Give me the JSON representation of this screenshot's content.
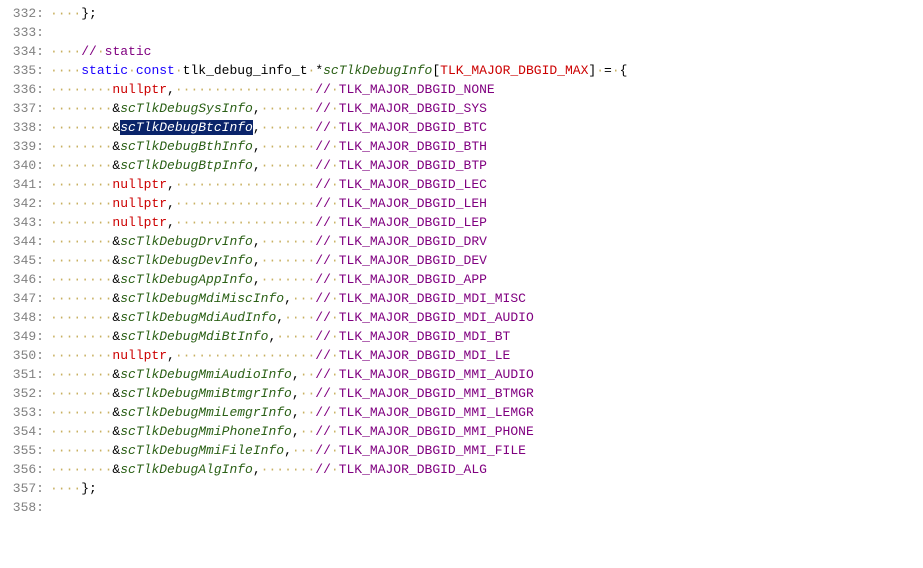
{
  "chart_data": null,
  "lines": [
    {
      "n": 332,
      "tokens": [
        {
          "t": "ws",
          "v": "····"
        },
        {
          "t": "num",
          "v": "};"
        }
      ]
    },
    {
      "n": 333,
      "tokens": []
    },
    {
      "n": 334,
      "tokens": [
        {
          "t": "ws",
          "v": "····"
        },
        {
          "t": "comment",
          "v": "//"
        },
        {
          "t": "ws",
          "v": "·"
        },
        {
          "t": "comment",
          "v": "static"
        }
      ]
    },
    {
      "n": 335,
      "tokens": [
        {
          "t": "ws",
          "v": "····"
        },
        {
          "t": "kw",
          "v": "static"
        },
        {
          "t": "ws",
          "v": "·"
        },
        {
          "t": "kw",
          "v": "const"
        },
        {
          "t": "ws",
          "v": "·"
        },
        {
          "t": "type",
          "v": "tlk_debug_info_t"
        },
        {
          "t": "ws",
          "v": "·"
        },
        {
          "t": "num",
          "v": "*"
        },
        {
          "t": "fn",
          "v": "scTlkDebugInfo"
        },
        {
          "t": "num",
          "v": "["
        },
        {
          "t": "red",
          "v": "TLK_MAJOR_DBGID_MAX"
        },
        {
          "t": "num",
          "v": "]"
        },
        {
          "t": "ws",
          "v": "·"
        },
        {
          "t": "num",
          "v": "="
        },
        {
          "t": "ws",
          "v": "·"
        },
        {
          "t": "num",
          "v": "{"
        }
      ]
    },
    {
      "n": 336,
      "tokens": [
        {
          "t": "ws",
          "v": "········"
        },
        {
          "t": "red",
          "v": "nullptr"
        },
        {
          "t": "num",
          "v": ","
        },
        {
          "t": "ws",
          "v": "··················"
        },
        {
          "t": "comment",
          "v": "//"
        },
        {
          "t": "ws",
          "v": "·"
        },
        {
          "t": "comment",
          "v": "TLK_MAJOR_DBGID_NONE"
        }
      ]
    },
    {
      "n": 337,
      "tokens": [
        {
          "t": "ws",
          "v": "········"
        },
        {
          "t": "num",
          "v": "&"
        },
        {
          "t": "fn",
          "v": "scTlkDebugSysInfo"
        },
        {
          "t": "num",
          "v": ","
        },
        {
          "t": "ws",
          "v": "·······"
        },
        {
          "t": "comment",
          "v": "//"
        },
        {
          "t": "ws",
          "v": "·"
        },
        {
          "t": "comment",
          "v": "TLK_MAJOR_DBGID_SYS"
        }
      ]
    },
    {
      "n": 338,
      "tokens": [
        {
          "t": "ws",
          "v": "········"
        },
        {
          "t": "num",
          "v": "&"
        },
        {
          "t": "fn",
          "v": "scTlkDebugBtcInfo",
          "sel": true
        },
        {
          "t": "num",
          "v": ","
        },
        {
          "t": "ws",
          "v": "·······"
        },
        {
          "t": "comment",
          "v": "//"
        },
        {
          "t": "ws",
          "v": "·"
        },
        {
          "t": "comment",
          "v": "TLK_MAJOR_DBGID_BTC"
        }
      ]
    },
    {
      "n": 339,
      "tokens": [
        {
          "t": "ws",
          "v": "········"
        },
        {
          "t": "num",
          "v": "&"
        },
        {
          "t": "fn",
          "v": "scTlkDebugBthInfo"
        },
        {
          "t": "num",
          "v": ","
        },
        {
          "t": "ws",
          "v": "·······"
        },
        {
          "t": "comment",
          "v": "//"
        },
        {
          "t": "ws",
          "v": "·"
        },
        {
          "t": "comment",
          "v": "TLK_MAJOR_DBGID_BTH"
        }
      ]
    },
    {
      "n": 340,
      "tokens": [
        {
          "t": "ws",
          "v": "········"
        },
        {
          "t": "num",
          "v": "&"
        },
        {
          "t": "fn",
          "v": "scTlkDebugBtpInfo"
        },
        {
          "t": "num",
          "v": ","
        },
        {
          "t": "ws",
          "v": "·······"
        },
        {
          "t": "comment",
          "v": "//"
        },
        {
          "t": "ws",
          "v": "·"
        },
        {
          "t": "comment",
          "v": "TLK_MAJOR_DBGID_BTP"
        }
      ]
    },
    {
      "n": 341,
      "tokens": [
        {
          "t": "ws",
          "v": "········"
        },
        {
          "t": "red",
          "v": "nullptr"
        },
        {
          "t": "num",
          "v": ","
        },
        {
          "t": "ws",
          "v": "··················"
        },
        {
          "t": "comment",
          "v": "//"
        },
        {
          "t": "ws",
          "v": "·"
        },
        {
          "t": "comment",
          "v": "TLK_MAJOR_DBGID_LEC"
        }
      ]
    },
    {
      "n": 342,
      "tokens": [
        {
          "t": "ws",
          "v": "········"
        },
        {
          "t": "red",
          "v": "nullptr"
        },
        {
          "t": "num",
          "v": ","
        },
        {
          "t": "ws",
          "v": "··················"
        },
        {
          "t": "comment",
          "v": "//"
        },
        {
          "t": "ws",
          "v": "·"
        },
        {
          "t": "comment",
          "v": "TLK_MAJOR_DBGID_LEH"
        }
      ]
    },
    {
      "n": 343,
      "tokens": [
        {
          "t": "ws",
          "v": "········"
        },
        {
          "t": "red",
          "v": "nullptr"
        },
        {
          "t": "num",
          "v": ","
        },
        {
          "t": "ws",
          "v": "··················"
        },
        {
          "t": "comment",
          "v": "//"
        },
        {
          "t": "ws",
          "v": "·"
        },
        {
          "t": "comment",
          "v": "TLK_MAJOR_DBGID_LEP"
        }
      ]
    },
    {
      "n": 344,
      "tokens": [
        {
          "t": "ws",
          "v": "········"
        },
        {
          "t": "num",
          "v": "&"
        },
        {
          "t": "fn",
          "v": "scTlkDebugDrvInfo"
        },
        {
          "t": "num",
          "v": ","
        },
        {
          "t": "ws",
          "v": "·······"
        },
        {
          "t": "comment",
          "v": "//"
        },
        {
          "t": "ws",
          "v": "·"
        },
        {
          "t": "comment",
          "v": "TLK_MAJOR_DBGID_DRV"
        }
      ]
    },
    {
      "n": 345,
      "tokens": [
        {
          "t": "ws",
          "v": "········"
        },
        {
          "t": "num",
          "v": "&"
        },
        {
          "t": "fn",
          "v": "scTlkDebugDevInfo"
        },
        {
          "t": "num",
          "v": ","
        },
        {
          "t": "ws",
          "v": "·······"
        },
        {
          "t": "comment",
          "v": "//"
        },
        {
          "t": "ws",
          "v": "·"
        },
        {
          "t": "comment",
          "v": "TLK_MAJOR_DBGID_DEV"
        }
      ]
    },
    {
      "n": 346,
      "tokens": [
        {
          "t": "ws",
          "v": "········"
        },
        {
          "t": "num",
          "v": "&"
        },
        {
          "t": "fn",
          "v": "scTlkDebugAppInfo"
        },
        {
          "t": "num",
          "v": ","
        },
        {
          "t": "ws",
          "v": "·······"
        },
        {
          "t": "comment",
          "v": "//"
        },
        {
          "t": "ws",
          "v": "·"
        },
        {
          "t": "comment",
          "v": "TLK_MAJOR_DBGID_APP"
        }
      ]
    },
    {
      "n": 347,
      "tokens": [
        {
          "t": "ws",
          "v": "········"
        },
        {
          "t": "num",
          "v": "&"
        },
        {
          "t": "fn",
          "v": "scTlkDebugMdiMiscInfo"
        },
        {
          "t": "num",
          "v": ","
        },
        {
          "t": "ws",
          "v": "···"
        },
        {
          "t": "comment",
          "v": "//"
        },
        {
          "t": "ws",
          "v": "·"
        },
        {
          "t": "comment",
          "v": "TLK_MAJOR_DBGID_MDI_MISC"
        }
      ]
    },
    {
      "n": 348,
      "tokens": [
        {
          "t": "ws",
          "v": "········"
        },
        {
          "t": "num",
          "v": "&"
        },
        {
          "t": "fn",
          "v": "scTlkDebugMdiAudInfo"
        },
        {
          "t": "num",
          "v": ","
        },
        {
          "t": "ws",
          "v": "····"
        },
        {
          "t": "comment",
          "v": "//"
        },
        {
          "t": "ws",
          "v": "·"
        },
        {
          "t": "comment",
          "v": "TLK_MAJOR_DBGID_MDI_AUDIO"
        }
      ]
    },
    {
      "n": 349,
      "tokens": [
        {
          "t": "ws",
          "v": "········"
        },
        {
          "t": "num",
          "v": "&"
        },
        {
          "t": "fn",
          "v": "scTlkDebugMdiBtInfo"
        },
        {
          "t": "num",
          "v": ","
        },
        {
          "t": "ws",
          "v": "·····"
        },
        {
          "t": "comment",
          "v": "//"
        },
        {
          "t": "ws",
          "v": "·"
        },
        {
          "t": "comment",
          "v": "TLK_MAJOR_DBGID_MDI_BT"
        }
      ]
    },
    {
      "n": 350,
      "tokens": [
        {
          "t": "ws",
          "v": "········"
        },
        {
          "t": "red",
          "v": "nullptr"
        },
        {
          "t": "num",
          "v": ","
        },
        {
          "t": "ws",
          "v": "··················"
        },
        {
          "t": "comment",
          "v": "//"
        },
        {
          "t": "ws",
          "v": "·"
        },
        {
          "t": "comment",
          "v": "TLK_MAJOR_DBGID_MDI_LE"
        }
      ]
    },
    {
      "n": 351,
      "tokens": [
        {
          "t": "ws",
          "v": "········"
        },
        {
          "t": "num",
          "v": "&"
        },
        {
          "t": "fn",
          "v": "scTlkDebugMmiAudioInfo"
        },
        {
          "t": "num",
          "v": ","
        },
        {
          "t": "ws",
          "v": "··"
        },
        {
          "t": "comment",
          "v": "//"
        },
        {
          "t": "ws",
          "v": "·"
        },
        {
          "t": "comment",
          "v": "TLK_MAJOR_DBGID_MMI_AUDIO"
        }
      ]
    },
    {
      "n": 352,
      "tokens": [
        {
          "t": "ws",
          "v": "········"
        },
        {
          "t": "num",
          "v": "&"
        },
        {
          "t": "fn",
          "v": "scTlkDebugMmiBtmgrInfo"
        },
        {
          "t": "num",
          "v": ","
        },
        {
          "t": "ws",
          "v": "··"
        },
        {
          "t": "comment",
          "v": "//"
        },
        {
          "t": "ws",
          "v": "·"
        },
        {
          "t": "comment",
          "v": "TLK_MAJOR_DBGID_MMI_BTMGR"
        }
      ]
    },
    {
      "n": 353,
      "tokens": [
        {
          "t": "ws",
          "v": "········"
        },
        {
          "t": "num",
          "v": "&"
        },
        {
          "t": "fn",
          "v": "scTlkDebugMmiLemgrInfo"
        },
        {
          "t": "num",
          "v": ","
        },
        {
          "t": "ws",
          "v": "··"
        },
        {
          "t": "comment",
          "v": "//"
        },
        {
          "t": "ws",
          "v": "·"
        },
        {
          "t": "comment",
          "v": "TLK_MAJOR_DBGID_MMI_LEMGR"
        }
      ]
    },
    {
      "n": 354,
      "tokens": [
        {
          "t": "ws",
          "v": "········"
        },
        {
          "t": "num",
          "v": "&"
        },
        {
          "t": "fn",
          "v": "scTlkDebugMmiPhoneInfo"
        },
        {
          "t": "num",
          "v": ","
        },
        {
          "t": "ws",
          "v": "··"
        },
        {
          "t": "comment",
          "v": "//"
        },
        {
          "t": "ws",
          "v": "·"
        },
        {
          "t": "comment",
          "v": "TLK_MAJOR_DBGID_MMI_PHONE"
        }
      ]
    },
    {
      "n": 355,
      "tokens": [
        {
          "t": "ws",
          "v": "········"
        },
        {
          "t": "num",
          "v": "&"
        },
        {
          "t": "fn",
          "v": "scTlkDebugMmiFileInfo"
        },
        {
          "t": "num",
          "v": ","
        },
        {
          "t": "ws",
          "v": "···"
        },
        {
          "t": "comment",
          "v": "//"
        },
        {
          "t": "ws",
          "v": "·"
        },
        {
          "t": "comment",
          "v": "TLK_MAJOR_DBGID_MMI_FILE"
        }
      ]
    },
    {
      "n": 356,
      "tokens": [
        {
          "t": "ws",
          "v": "········"
        },
        {
          "t": "num",
          "v": "&"
        },
        {
          "t": "fn",
          "v": "scTlkDebugAlgInfo"
        },
        {
          "t": "num",
          "v": ","
        },
        {
          "t": "ws",
          "v": "·······"
        },
        {
          "t": "comment",
          "v": "//"
        },
        {
          "t": "ws",
          "v": "·"
        },
        {
          "t": "comment",
          "v": "TLK_MAJOR_DBGID_ALG"
        }
      ]
    },
    {
      "n": 357,
      "tokens": [
        {
          "t": "ws",
          "v": "····"
        },
        {
          "t": "num",
          "v": "};"
        }
      ]
    },
    {
      "n": 358,
      "tokens": []
    }
  ]
}
